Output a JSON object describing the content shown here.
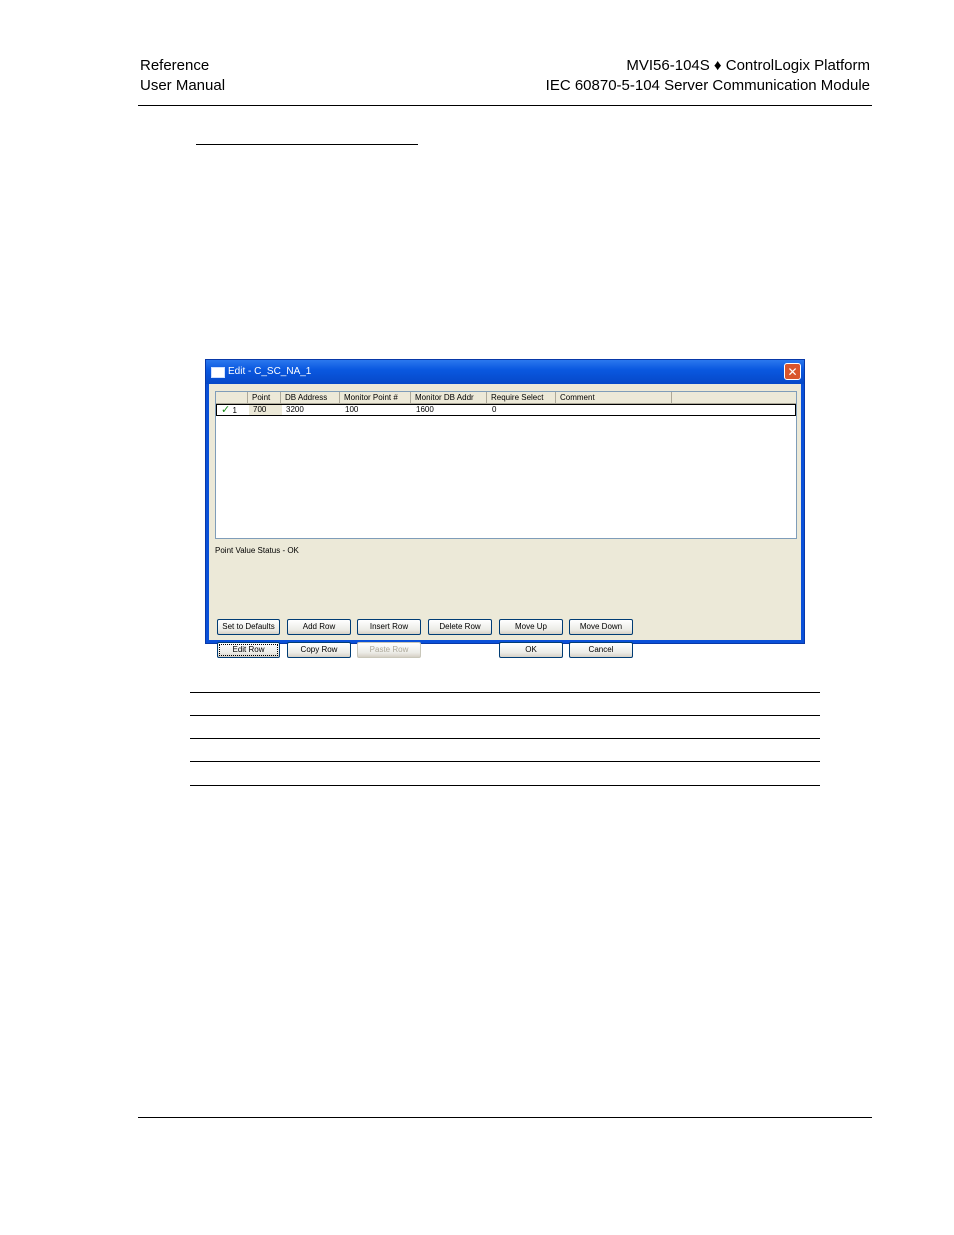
{
  "header": {
    "left_line1": "Reference",
    "left_line2": "User Manual",
    "right_line1": "MVI56-104S ♦ ControlLogix Platform",
    "right_line2": "IEC 60870-5-104 Server Communication Module"
  },
  "dialog": {
    "title": "Edit - C_SC_NA_1",
    "close_symbol": "✕",
    "columns": [
      "Point",
      "DB Address",
      "Monitor Point #",
      "Monitor DB Addr",
      "Require Select",
      "Comment"
    ],
    "rows": [
      {
        "index": "1",
        "check": "✓",
        "point": "700",
        "db_address": "3200",
        "monitor_point": "100",
        "monitor_db_addr": "1600",
        "require_select": "0",
        "comment": ""
      }
    ],
    "status": "Point Value Status - OK",
    "buttons": {
      "set_defaults": "Set to Defaults",
      "add_row": "Add Row",
      "insert_row": "Insert Row",
      "delete_row": "Delete Row",
      "move_up": "Move Up",
      "move_down": "Move Down",
      "edit_row": "Edit Row",
      "copy_row": "Copy Row",
      "paste_row": "Paste Row",
      "ok": "OK",
      "cancel": "Cancel"
    }
  },
  "colors": {
    "titlebar": "#0a58e0",
    "dialog_face": "#ece9d8",
    "close_button": "#d9552c"
  }
}
